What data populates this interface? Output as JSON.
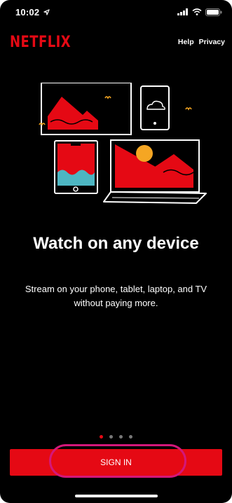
{
  "status_bar": {
    "time": "10:02",
    "icons": [
      "location-arrow-icon",
      "signal-icon",
      "wifi-icon",
      "battery-icon"
    ]
  },
  "header": {
    "logo": "NETFLIX",
    "links": [
      "Help",
      "Privacy"
    ]
  },
  "onboarding": {
    "title": "Watch on any device",
    "description": "Stream on your phone, tablet, laptop, and TV without paying more.",
    "page_count": 4,
    "active_page": 1
  },
  "actions": {
    "sign_in_label": "SIGN IN"
  },
  "colors": {
    "background": "#000000",
    "brand_red": "#e50914",
    "accent_orange": "#f5a623",
    "accent_teal": "#4db6c2",
    "highlight_pink": "#d4177a"
  }
}
